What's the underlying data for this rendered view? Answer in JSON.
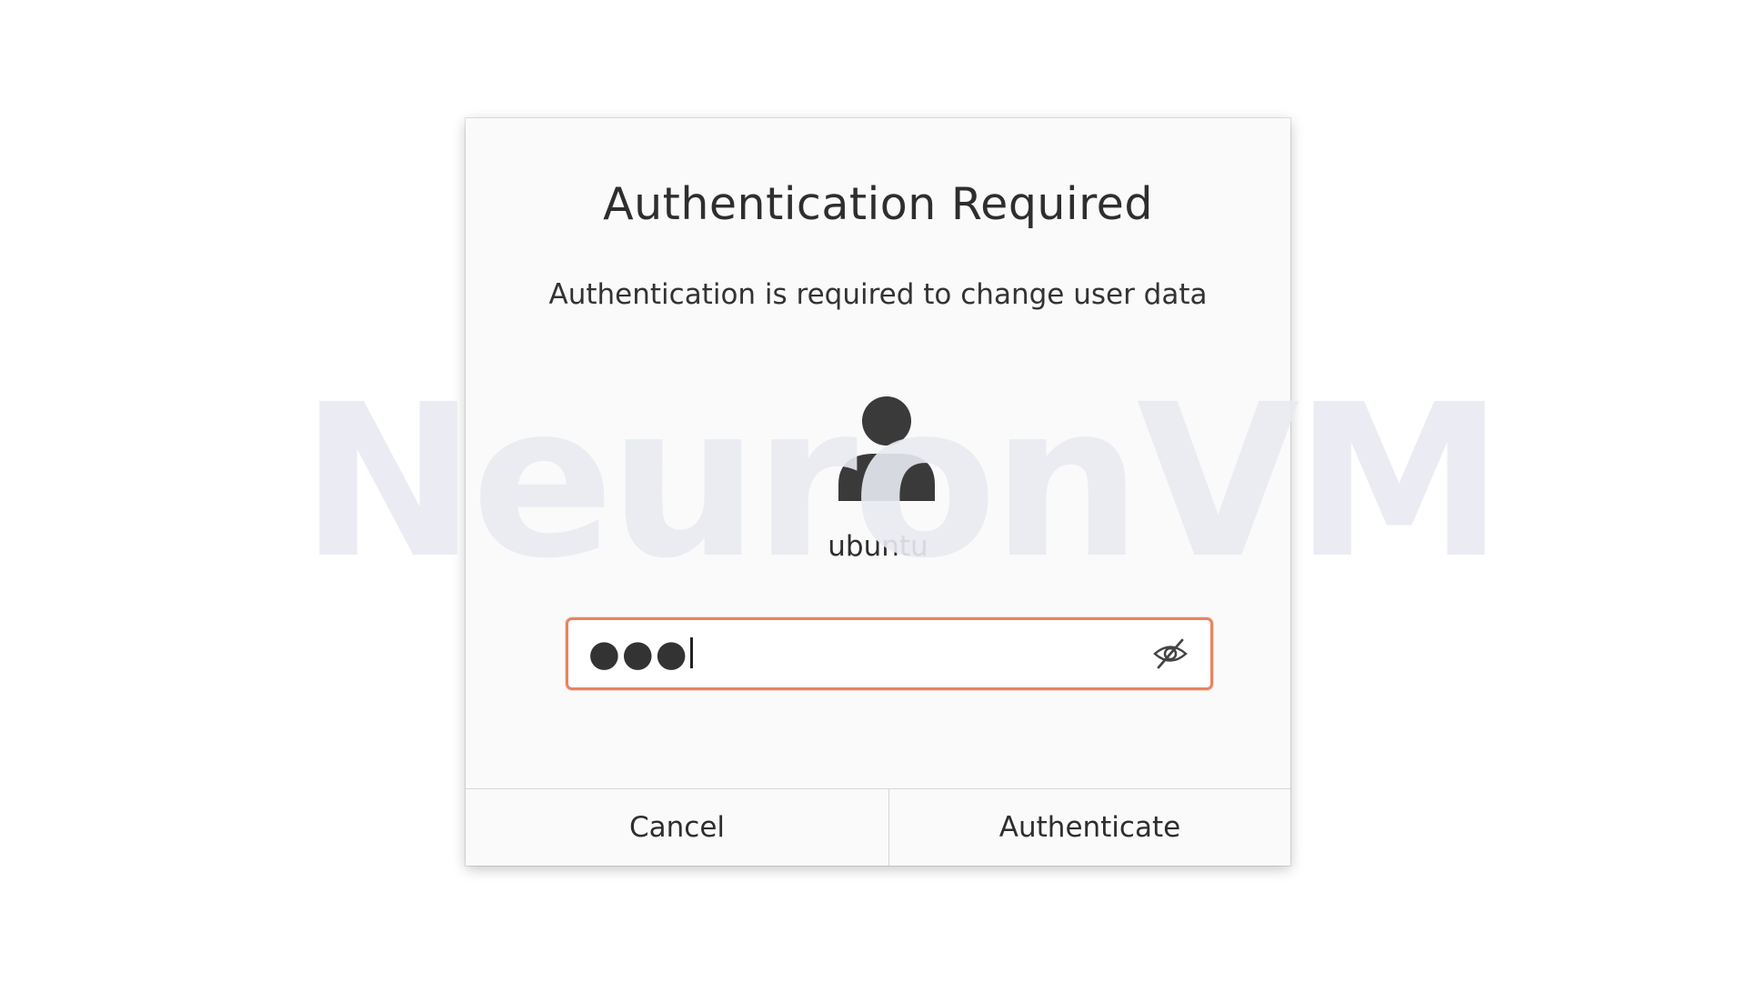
{
  "dialog": {
    "title": "Authentication Required",
    "message": "Authentication is required to change user data",
    "user": {
      "name": "ubuntu",
      "avatar_icon": "user-avatar-icon"
    },
    "password": {
      "masked_value": "●●●",
      "toggle_icon": "eye-hidden-icon"
    },
    "buttons": {
      "cancel": "Cancel",
      "authenticate": "Authenticate"
    },
    "colors": {
      "focus_border": "#e9835f",
      "background": "#fafafa",
      "text": "#2e2e2e"
    }
  },
  "watermark": {
    "text": "NeuronVM"
  }
}
